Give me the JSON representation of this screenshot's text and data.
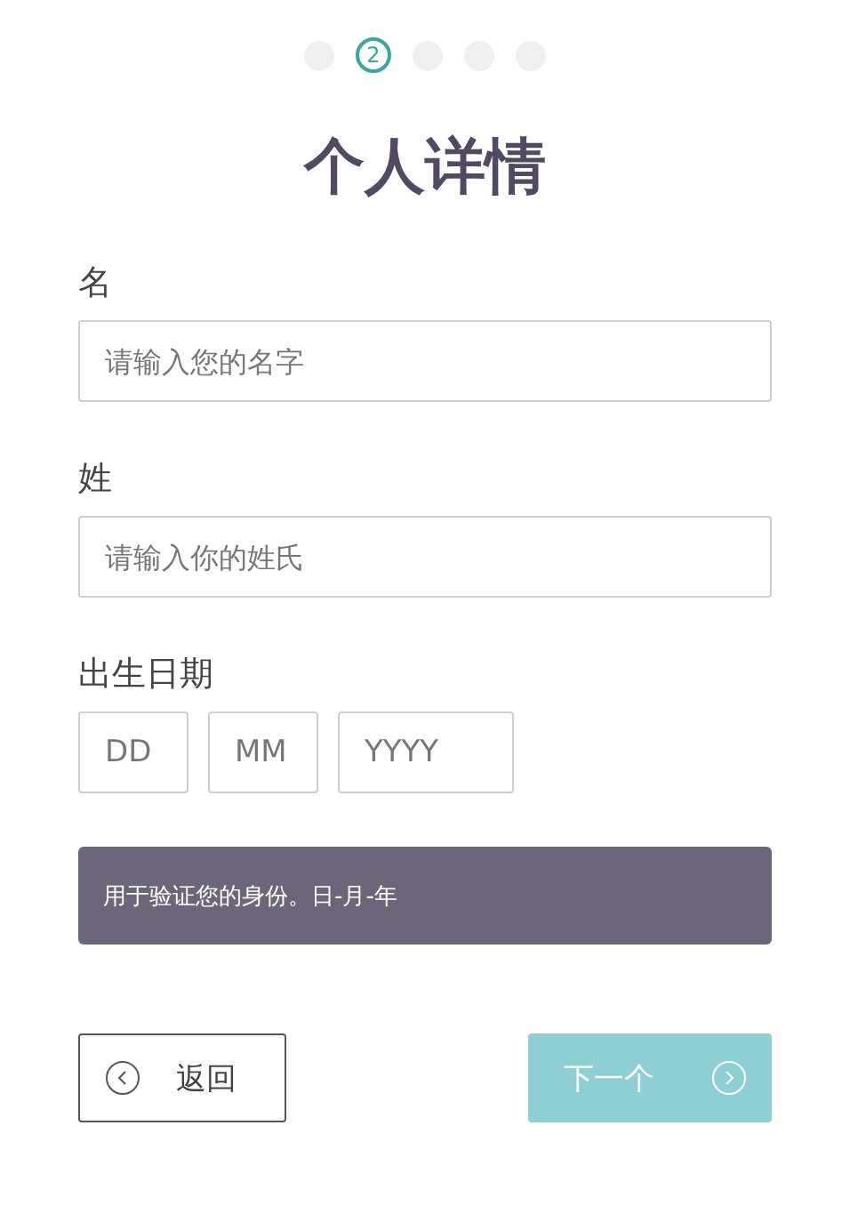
{
  "steps": [
    {
      "selected": false
    },
    {
      "selected": true,
      "label": "2"
    },
    {
      "selected": false
    },
    {
      "selected": false
    },
    {
      "selected": false
    }
  ],
  "title": "个人详情",
  "fields": [
    {
      "label": "名",
      "placeholder": "请输入您的名字"
    },
    {
      "label": "姓",
      "placeholder": "请输入你的姓氏"
    }
  ],
  "birth_date": {
    "label": "出生日期",
    "parts": [
      {
        "placeholder": "DD",
        "kind": "short"
      },
      {
        "placeholder": "MM",
        "kind": "short"
      },
      {
        "placeholder": "YYYY",
        "kind": "wide"
      }
    ]
  },
  "hint": "用于验证您的身份。日-月-年",
  "back_button": {
    "label": "返回"
  },
  "next_button": {
    "label": "下一个",
    "disabled": true
  }
}
